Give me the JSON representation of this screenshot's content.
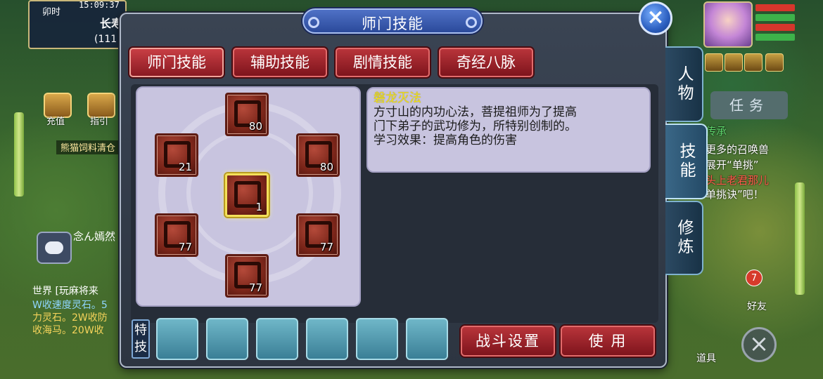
{
  "hud": {
    "time_label": "卯时",
    "clock": "15:09:37",
    "map_name": "长寿",
    "map_coord": "(111",
    "left_buttons": [
      "充值",
      "指引"
    ],
    "notice": "熊猫饲料清仓",
    "pet_name": "念ん嫣然",
    "chat_lines": [
      {
        "text": "世界 [玩麻将来",
        "color": "#ffffff"
      },
      {
        "text": "W收速度灵石。5",
        "color": "#8fd6ff"
      },
      {
        "text": "力灵石。2W收防",
        "color": "#f5d35a"
      },
      {
        "text": "收海马。20W收",
        "color": "#f5d35a"
      }
    ],
    "task_button": "任务",
    "task_lines": [
      {
        "text": "传承",
        "color": "#5dd36a"
      },
      {
        "text": "更多的召唤兽",
        "color": "#ffffff"
      },
      {
        "text": "展开“单挑”",
        "color": "#ffffff"
      },
      {
        "text": "头上老君那儿",
        "color": "#ff5a4a"
      },
      {
        "text": "单挑诀”吧！",
        "color": "#ffffff"
      }
    ],
    "friend_badge": "7",
    "friend_label": "好友",
    "bag_label": "道具",
    "close_icon": "×"
  },
  "panel": {
    "title": "师门技能",
    "close": "×",
    "tabs": [
      {
        "label": "师门技能",
        "active": true
      },
      {
        "label": "辅助技能",
        "active": false
      },
      {
        "label": "剧情技能",
        "active": false
      },
      {
        "label": "奇经八脉",
        "active": false
      }
    ],
    "side_tabs": [
      {
        "label": "人物",
        "active": false
      },
      {
        "label": "技能",
        "active": true
      },
      {
        "label": "修炼",
        "active": false
      }
    ],
    "skills": [
      {
        "name": "skill-top",
        "level": "80",
        "selected": false
      },
      {
        "name": "skill-upper-left",
        "level": "21",
        "selected": false
      },
      {
        "name": "skill-upper-right",
        "level": "80",
        "selected": false
      },
      {
        "name": "skill-center",
        "level": "1",
        "selected": true
      },
      {
        "name": "skill-lower-left",
        "level": "77",
        "selected": false
      },
      {
        "name": "skill-lower-right",
        "level": "77",
        "selected": false
      },
      {
        "name": "skill-bottom",
        "level": "77",
        "selected": false
      }
    ],
    "description": {
      "title": "磐龙灭法",
      "lines": [
        "方寸山的内功心法，菩提祖师为了提高",
        "门下弟子的武功修为，所特别创制的。",
        "学习效果：提高角色的伤害"
      ]
    },
    "special_label": "特技",
    "slots": 6,
    "buttons": {
      "battle_settings": "战斗设置",
      "use": "使 用"
    }
  },
  "colors": {
    "tab_red": "#9a2128",
    "title_blue": "#3a5cb3",
    "desc_title": "#f4e31a",
    "panel_bg": "#333c49",
    "slot_teal": "#4f98ad"
  }
}
